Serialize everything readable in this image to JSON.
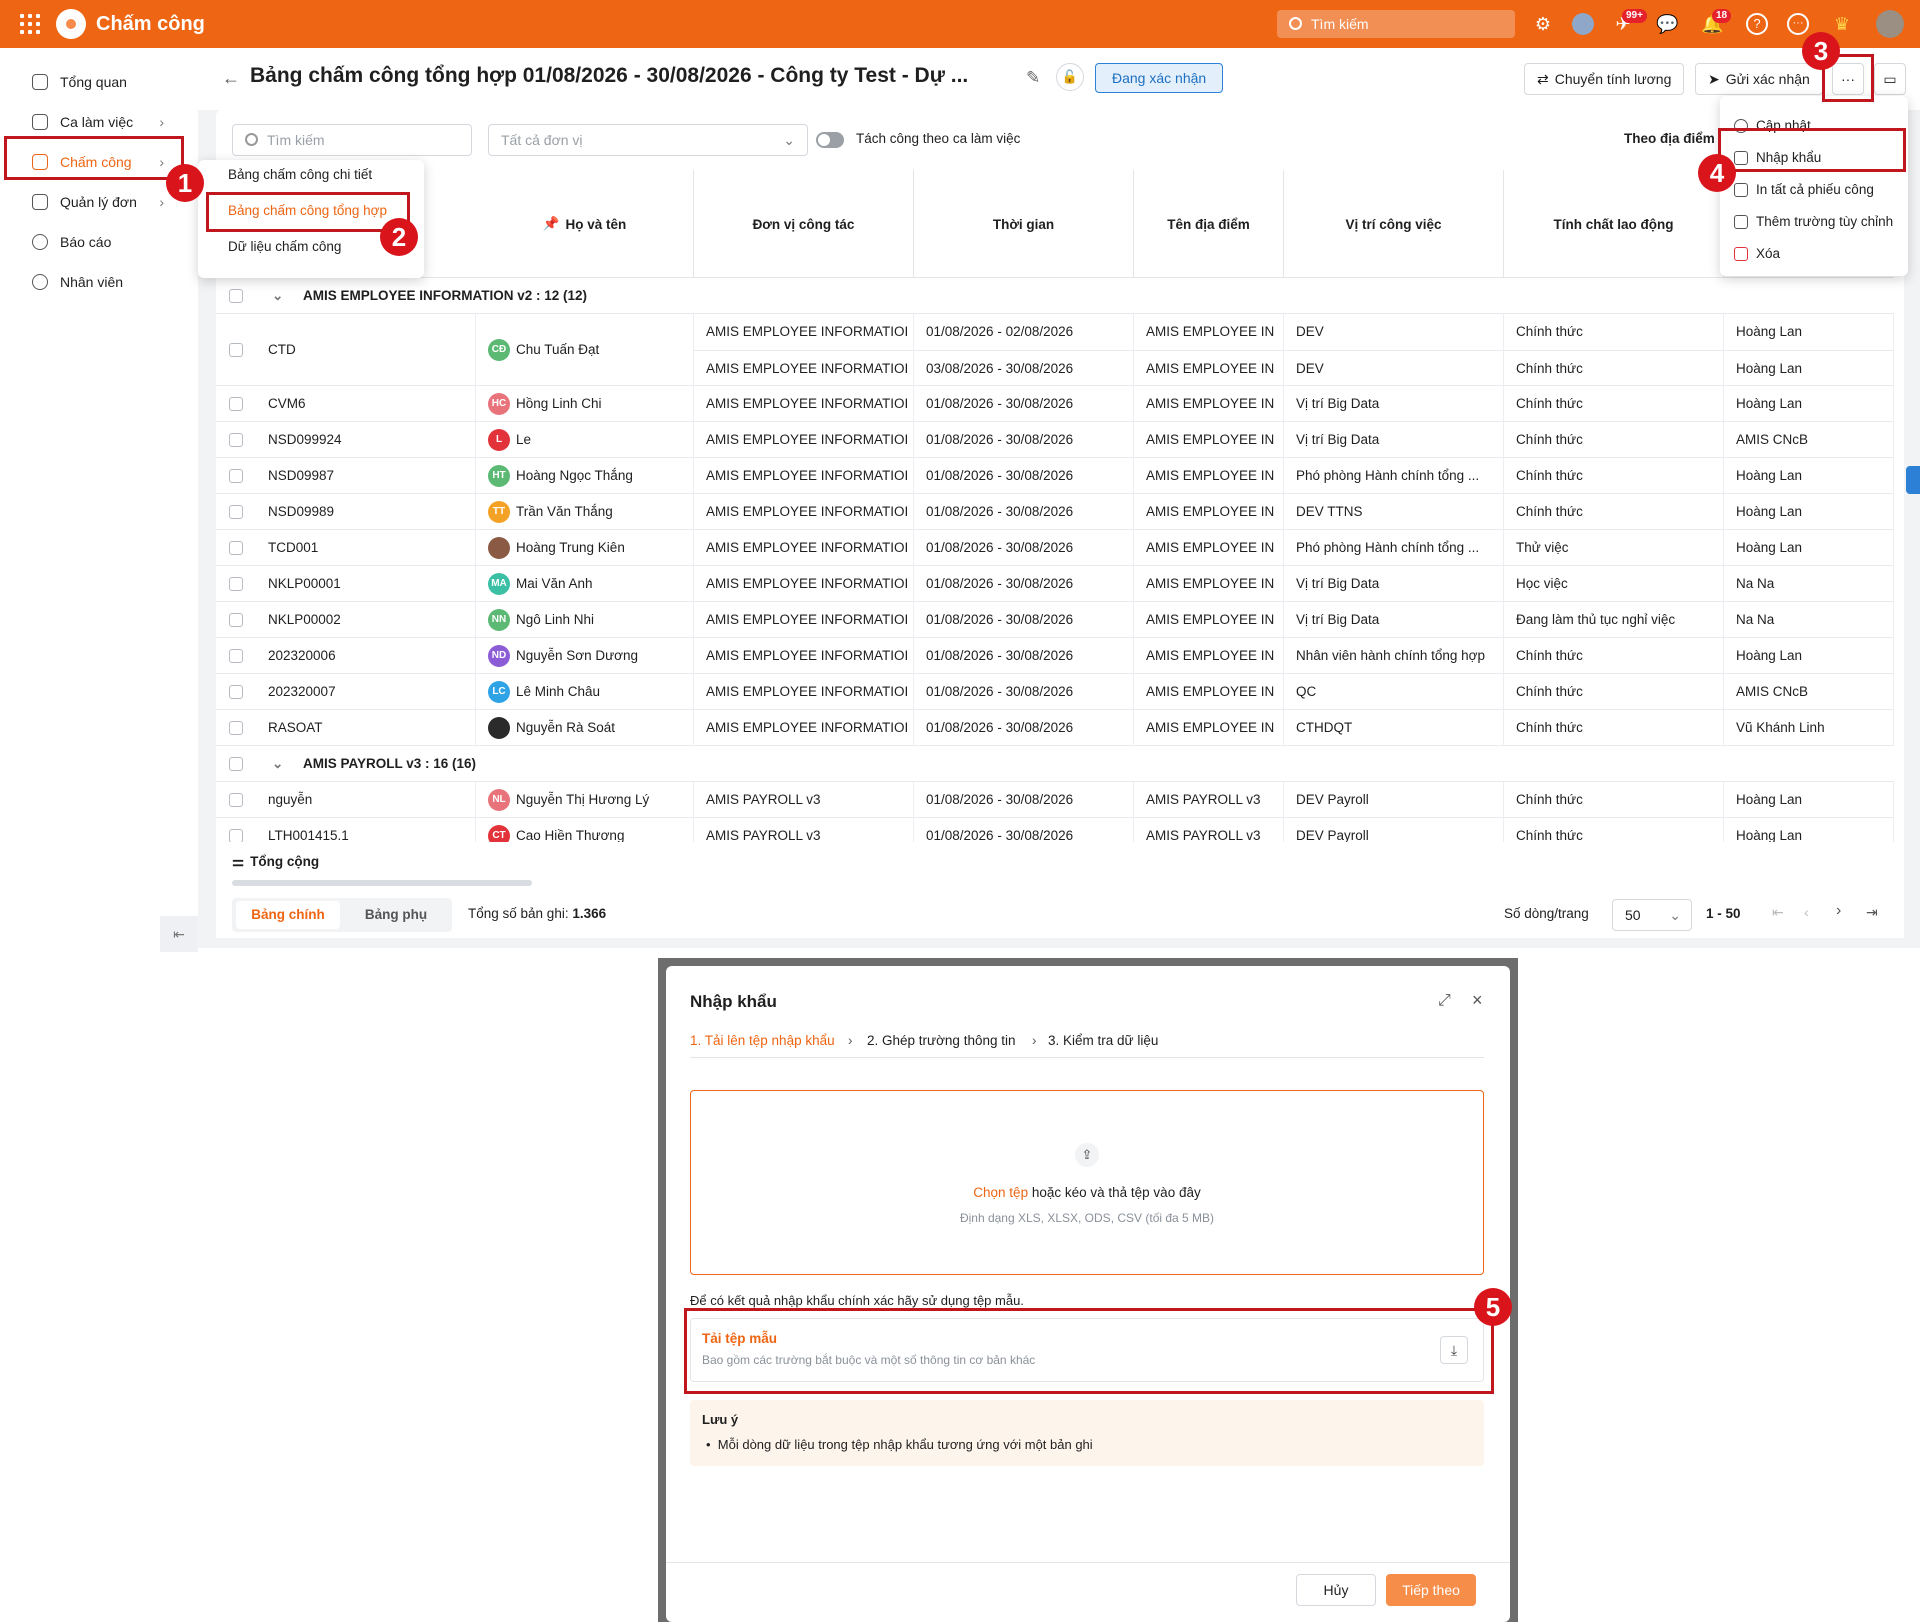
{
  "app": {
    "title": "Chấm công",
    "search_placeholder": "Tìm kiếm",
    "msg_badge": "99+",
    "notif_badge": "18"
  },
  "sidebar": {
    "items": [
      {
        "label": "Tổng quan"
      },
      {
        "label": "Ca làm việc"
      },
      {
        "label": "Chấm công"
      },
      {
        "label": "Quản lý đơn"
      },
      {
        "label": "Báo cáo"
      },
      {
        "label": "Nhân viên"
      }
    ]
  },
  "submenu": {
    "items": [
      "Bảng chấm công chi tiết",
      "Bảng chấm công tổng hợp",
      "Dữ liệu chấm công"
    ]
  },
  "page": {
    "title": "Bảng chấm công tổng hợp 01/08/2026 - 30/08/2026 - Công ty Test - Dự ...",
    "status": "Đang xác nhận",
    "btn_payroll": "Chuyển tính lương",
    "btn_send": "Gửi xác nhận",
    "more_icon": "···"
  },
  "more_menu": {
    "items": [
      "Cập nhật",
      "Nhập khẩu",
      "In tất cả phiếu công",
      "Thêm trường tùy chỉnh",
      "Xóa"
    ]
  },
  "filters": {
    "search_placeholder": "Tìm kiếm",
    "unit_placeholder": "Tất cả đơn vị",
    "toggle_label": "Tách công theo ca làm việc",
    "right_label": "Theo địa điểm"
  },
  "table": {
    "headers": [
      "Họ và tên",
      "Đơn vị công tác",
      "Thời gian",
      "Tên địa điểm",
      "Vị trí công việc",
      "Tính chất lao động"
    ],
    "groups": [
      {
        "label": "AMIS EMPLOYEE INFORMATION v2 : 12 (12)"
      },
      {
        "label": "AMIS PAYROLL v3 : 16 (16)"
      }
    ],
    "rows": [
      {
        "code": "CTD",
        "name": "Chu Tuấn Đạt",
        "initials": "CĐ",
        "color": "#5bb974",
        "unit": "AMIS EMPLOYEE INFORMATIOI",
        "time": "01/08/2026 - 02/08/2026",
        "place": "AMIS EMPLOYEE IN",
        "pos": "DEV",
        "type": "Chính thức",
        "mgr": "Hoàng Lan",
        "unit2": "AMIS EMPLOYEE INFORMATIOI",
        "time2": "03/08/2026 - 30/08/2026",
        "place2": "AMIS EMPLOYEE IN",
        "pos2": "DEV",
        "type2": "Chính thức",
        "mgr2": "Hoàng Lan"
      },
      {
        "code": "CVM6",
        "name": "Hồng Linh Chi",
        "initials": "HC",
        "color": "#e8737b",
        "unit": "AMIS EMPLOYEE INFORMATIOI",
        "time": "01/08/2026 - 30/08/2026",
        "place": "AMIS EMPLOYEE IN",
        "pos": "Vị trí Big Data",
        "type": "Chính thức",
        "mgr": "Hoàng Lan"
      },
      {
        "code": "NSD099924",
        "name": "Le",
        "initials": "L",
        "color": "#e2333a",
        "unit": "AMIS EMPLOYEE INFORMATIOI",
        "time": "01/08/2026 - 30/08/2026",
        "place": "AMIS EMPLOYEE IN",
        "pos": "Vị trí Big Data",
        "type": "Chính thức",
        "mgr": "AMIS CNcB"
      },
      {
        "code": "NSD09987",
        "name": "Hoàng Ngọc Thắng",
        "initials": "HT",
        "color": "#5bb974",
        "unit": "AMIS EMPLOYEE INFORMATIOI",
        "time": "01/08/2026 - 30/08/2026",
        "place": "AMIS EMPLOYEE IN",
        "pos": "Phó phòng Hành chính tổng ...",
        "type": "Chính thức",
        "mgr": "Hoàng Lan"
      },
      {
        "code": "NSD09989",
        "name": "Trần Văn Thắng",
        "initials": "TT",
        "color": "#f4a226",
        "unit": "AMIS EMPLOYEE INFORMATIOI",
        "time": "01/08/2026 - 30/08/2026",
        "place": "AMIS EMPLOYEE IN",
        "pos": "DEV TTNS",
        "type": "Chính thức",
        "mgr": "Hoàng Lan"
      },
      {
        "code": "TCD001",
        "name": "Hoàng Trung Kiên",
        "initials": "",
        "color": "#8a5a44",
        "unit": "AMIS EMPLOYEE INFORMATIOI",
        "time": "01/08/2026 - 30/08/2026",
        "place": "AMIS EMPLOYEE IN",
        "pos": "Phó phòng Hành chính tổng ...",
        "type": "Thử việc",
        "mgr": "Hoàng Lan"
      },
      {
        "code": "NKLP00001",
        "name": "Mai Văn Anh",
        "initials": "MA",
        "color": "#3cc0a5",
        "unit": "AMIS EMPLOYEE INFORMATIOI",
        "time": "01/08/2026 - 30/08/2026",
        "place": "AMIS EMPLOYEE IN",
        "pos": "Vị trí Big Data",
        "type": "Học việc",
        "mgr": "Na Na"
      },
      {
        "code": "NKLP00002",
        "name": "Ngô Linh Nhi",
        "initials": "NN",
        "color": "#5bb974",
        "unit": "AMIS EMPLOYEE INFORMATIOI",
        "time": "01/08/2026 - 30/08/2026",
        "place": "AMIS EMPLOYEE IN",
        "pos": "Vị trí Big Data",
        "type": "Đang làm thủ tục nghỉ việc",
        "mgr": "Na Na"
      },
      {
        "code": "202320006",
        "name": "Nguyễn Sơn Dương",
        "initials": "ND",
        "color": "#8b5cd6",
        "unit": "AMIS EMPLOYEE INFORMATIOI",
        "time": "01/08/2026 - 30/08/2026",
        "place": "AMIS EMPLOYEE IN",
        "pos": "Nhân viên hành chính tổng hợp",
        "type": "Chính thức",
        "mgr": "Hoàng Lan"
      },
      {
        "code": "202320007",
        "name": "Lê Minh Châu",
        "initials": "LC",
        "color": "#2ea3e6",
        "unit": "AMIS EMPLOYEE INFORMATIOI",
        "time": "01/08/2026 - 30/08/2026",
        "place": "AMIS EMPLOYEE IN",
        "pos": "QC",
        "type": "Chính thức",
        "mgr": "AMIS CNcB"
      },
      {
        "code": "RASOAT",
        "name": "Nguyễn Rà Soát",
        "initials": "",
        "color": "#2b2b2b",
        "unit": "AMIS EMPLOYEE INFORMATIOI",
        "time": "01/08/2026 - 30/08/2026",
        "place": "AMIS EMPLOYEE IN",
        "pos": "CTHDQT",
        "type": "Chính thức",
        "mgr": "Vũ Khánh Linh"
      },
      {
        "code": "nguyễn",
        "name": "Nguyễn Thị Hương Lý",
        "initials": "NL",
        "color": "#e8737b",
        "unit": "AMIS PAYROLL v3",
        "time": "01/08/2026 - 30/08/2026",
        "place": "AMIS PAYROLL v3",
        "pos": "DEV Payroll",
        "type": "Chính thức",
        "mgr": "Hoàng Lan"
      },
      {
        "code": "LTH001415.1",
        "name": "Cao Hiền Thương",
        "initials": "CT",
        "color": "#e2333a",
        "unit": "AMIS PAYROLL v3",
        "time": "01/08/2026 - 30/08/2026",
        "place": "AMIS PAYROLL v3",
        "pos": "DEV Payroll",
        "type": "Chính thức",
        "mgr": "Hoàng Lan"
      }
    ],
    "total_label": "Tổng cộng"
  },
  "footer": {
    "tab_main": "Bảng chính",
    "tab_sub": "Bảng phụ",
    "record_label": "Tổng số bản ghi:",
    "record_count": "1.366",
    "rows_per_page_label": "Số dòng/trang",
    "rows_per_page": "50",
    "range": "1 - 50"
  },
  "annotations": [
    "1",
    "2",
    "3",
    "4",
    "5"
  ],
  "modal": {
    "title": "Nhập khẩu",
    "steps": [
      "1. Tải lên tệp nhập khẩu",
      "2. Ghép trường thông tin",
      "3. Kiểm tra dữ liệu"
    ],
    "choose_file": "Chọn tệp",
    "drop_text": "hoặc kéo và thả tệp vào đây",
    "format_hint": "Định dạng XLS, XLSX, ODS, CSV (tối đa 5 MB)",
    "template_hint": "Để có kết quả nhập khẩu chính xác hãy sử dụng tệp mẫu.",
    "template_title": "Tải tệp mẫu",
    "template_desc": "Bao gồm các trường bắt buộc và một số thông tin cơ bản khác",
    "note_title": "Lưu ý",
    "note_item": "Mỗi dòng dữ liệu trong tệp nhập khẩu tương ứng với một bản ghi",
    "cancel": "Hủy",
    "next": "Tiếp theo"
  },
  "colors": {
    "accent": "#ee6513",
    "annotation": "#d9141b",
    "status_blue": "#1e6fc2"
  }
}
